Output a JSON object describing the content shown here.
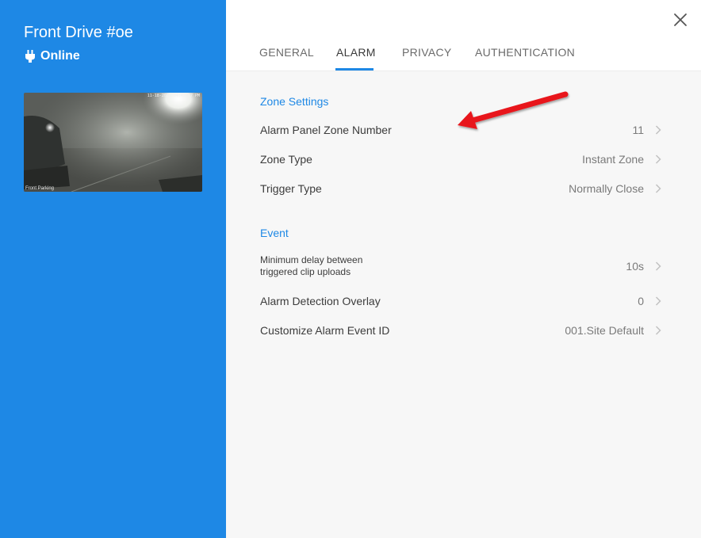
{
  "camera": {
    "title": "Front Drive #oe",
    "status": "Online",
    "preview_timestamp": "11-18-2018 04:45:07 PM",
    "preview_label": "Front Parking"
  },
  "tabs": [
    {
      "label": "GENERAL",
      "active": false
    },
    {
      "label": "ALARM",
      "active": true
    },
    {
      "label": "PRIVACY",
      "active": false
    },
    {
      "label": "AUTHENTICATION",
      "active": false
    }
  ],
  "sections": {
    "zone_settings": {
      "title": "Zone Settings",
      "rows": [
        {
          "label": "Alarm Panel Zone Number",
          "value": "11"
        },
        {
          "label": "Zone Type",
          "value": "Instant Zone"
        },
        {
          "label": "Trigger Type",
          "value": "Normally Close"
        }
      ]
    },
    "event": {
      "title": "Event",
      "rows": [
        {
          "label_line1": "Minimum delay between",
          "label_line2": "triggered clip uploads",
          "value": "10s"
        },
        {
          "label": "Alarm Detection Overlay",
          "value": "0"
        },
        {
          "label": "Customize Alarm Event ID",
          "value": "001.Site Default"
        }
      ]
    }
  },
  "colors": {
    "accent": "#1e88e5",
    "annotation_arrow": "#e8161b"
  },
  "icons": {
    "status": "plug-icon",
    "close": "close-icon",
    "row_chevron": "chevron-right-icon"
  }
}
